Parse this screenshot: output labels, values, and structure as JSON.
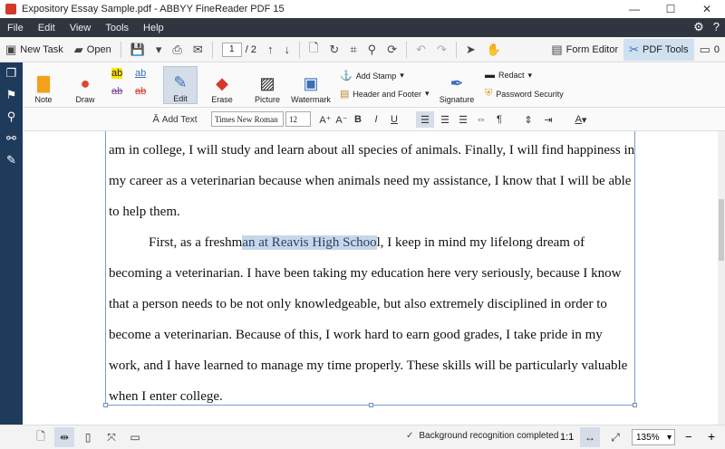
{
  "window": {
    "title": "Expository Essay Sample.pdf - ABBYY FineReader PDF 15"
  },
  "menu": [
    "File",
    "Edit",
    "View",
    "Tools",
    "Help"
  ],
  "toolbar": {
    "new_task": "New Task",
    "open": "Open",
    "page_current": "1",
    "page_total": "/ 2",
    "form_editor": "Form Editor",
    "pdf_tools": "PDF Tools",
    "comments_count": "0"
  },
  "ribbon": {
    "note": "Note",
    "draw": "Draw",
    "edit": "Edit",
    "erase": "Erase",
    "picture": "Picture",
    "watermark": "Watermark",
    "add_stamp": "Add Stamp",
    "header_footer": "Header and Footer",
    "signature": "Signature",
    "redact": "Redact",
    "password_security": "Password Security",
    "ab_label": "ab"
  },
  "format": {
    "add_text": "Add Text",
    "font_name": "Times New Roman",
    "font_size": "12",
    "bold": "B",
    "italic": "I",
    "underline": "U"
  },
  "document": {
    "lines": [
      "am in college, I will study and learn about all species of animals. Finally, I will find happiness in",
      "my career as a veterinarian because when animals need my assistance, I know that I will be able",
      "to help them.",
      "becoming a veterinarian.  I have been taking my education here very seriously, because I know",
      "that a person needs to be not only knowledgeable, but also extremely disciplined in order to",
      "become a veterinarian.  Because of this, I work hard to earn good grades, I take pride in my",
      "work, and I have learned to manage my time properly.  These skills will be particularly valuable",
      "when I enter college."
    ],
    "para2_before": "First, as a freshm",
    "para2_highlight": "an at Reavis High Schoo",
    "para2_after": "l, I keep in mind my lifelong dream of"
  },
  "status": {
    "text": "Background recognition completed",
    "ratio": "1:1",
    "zoom": "135%"
  }
}
